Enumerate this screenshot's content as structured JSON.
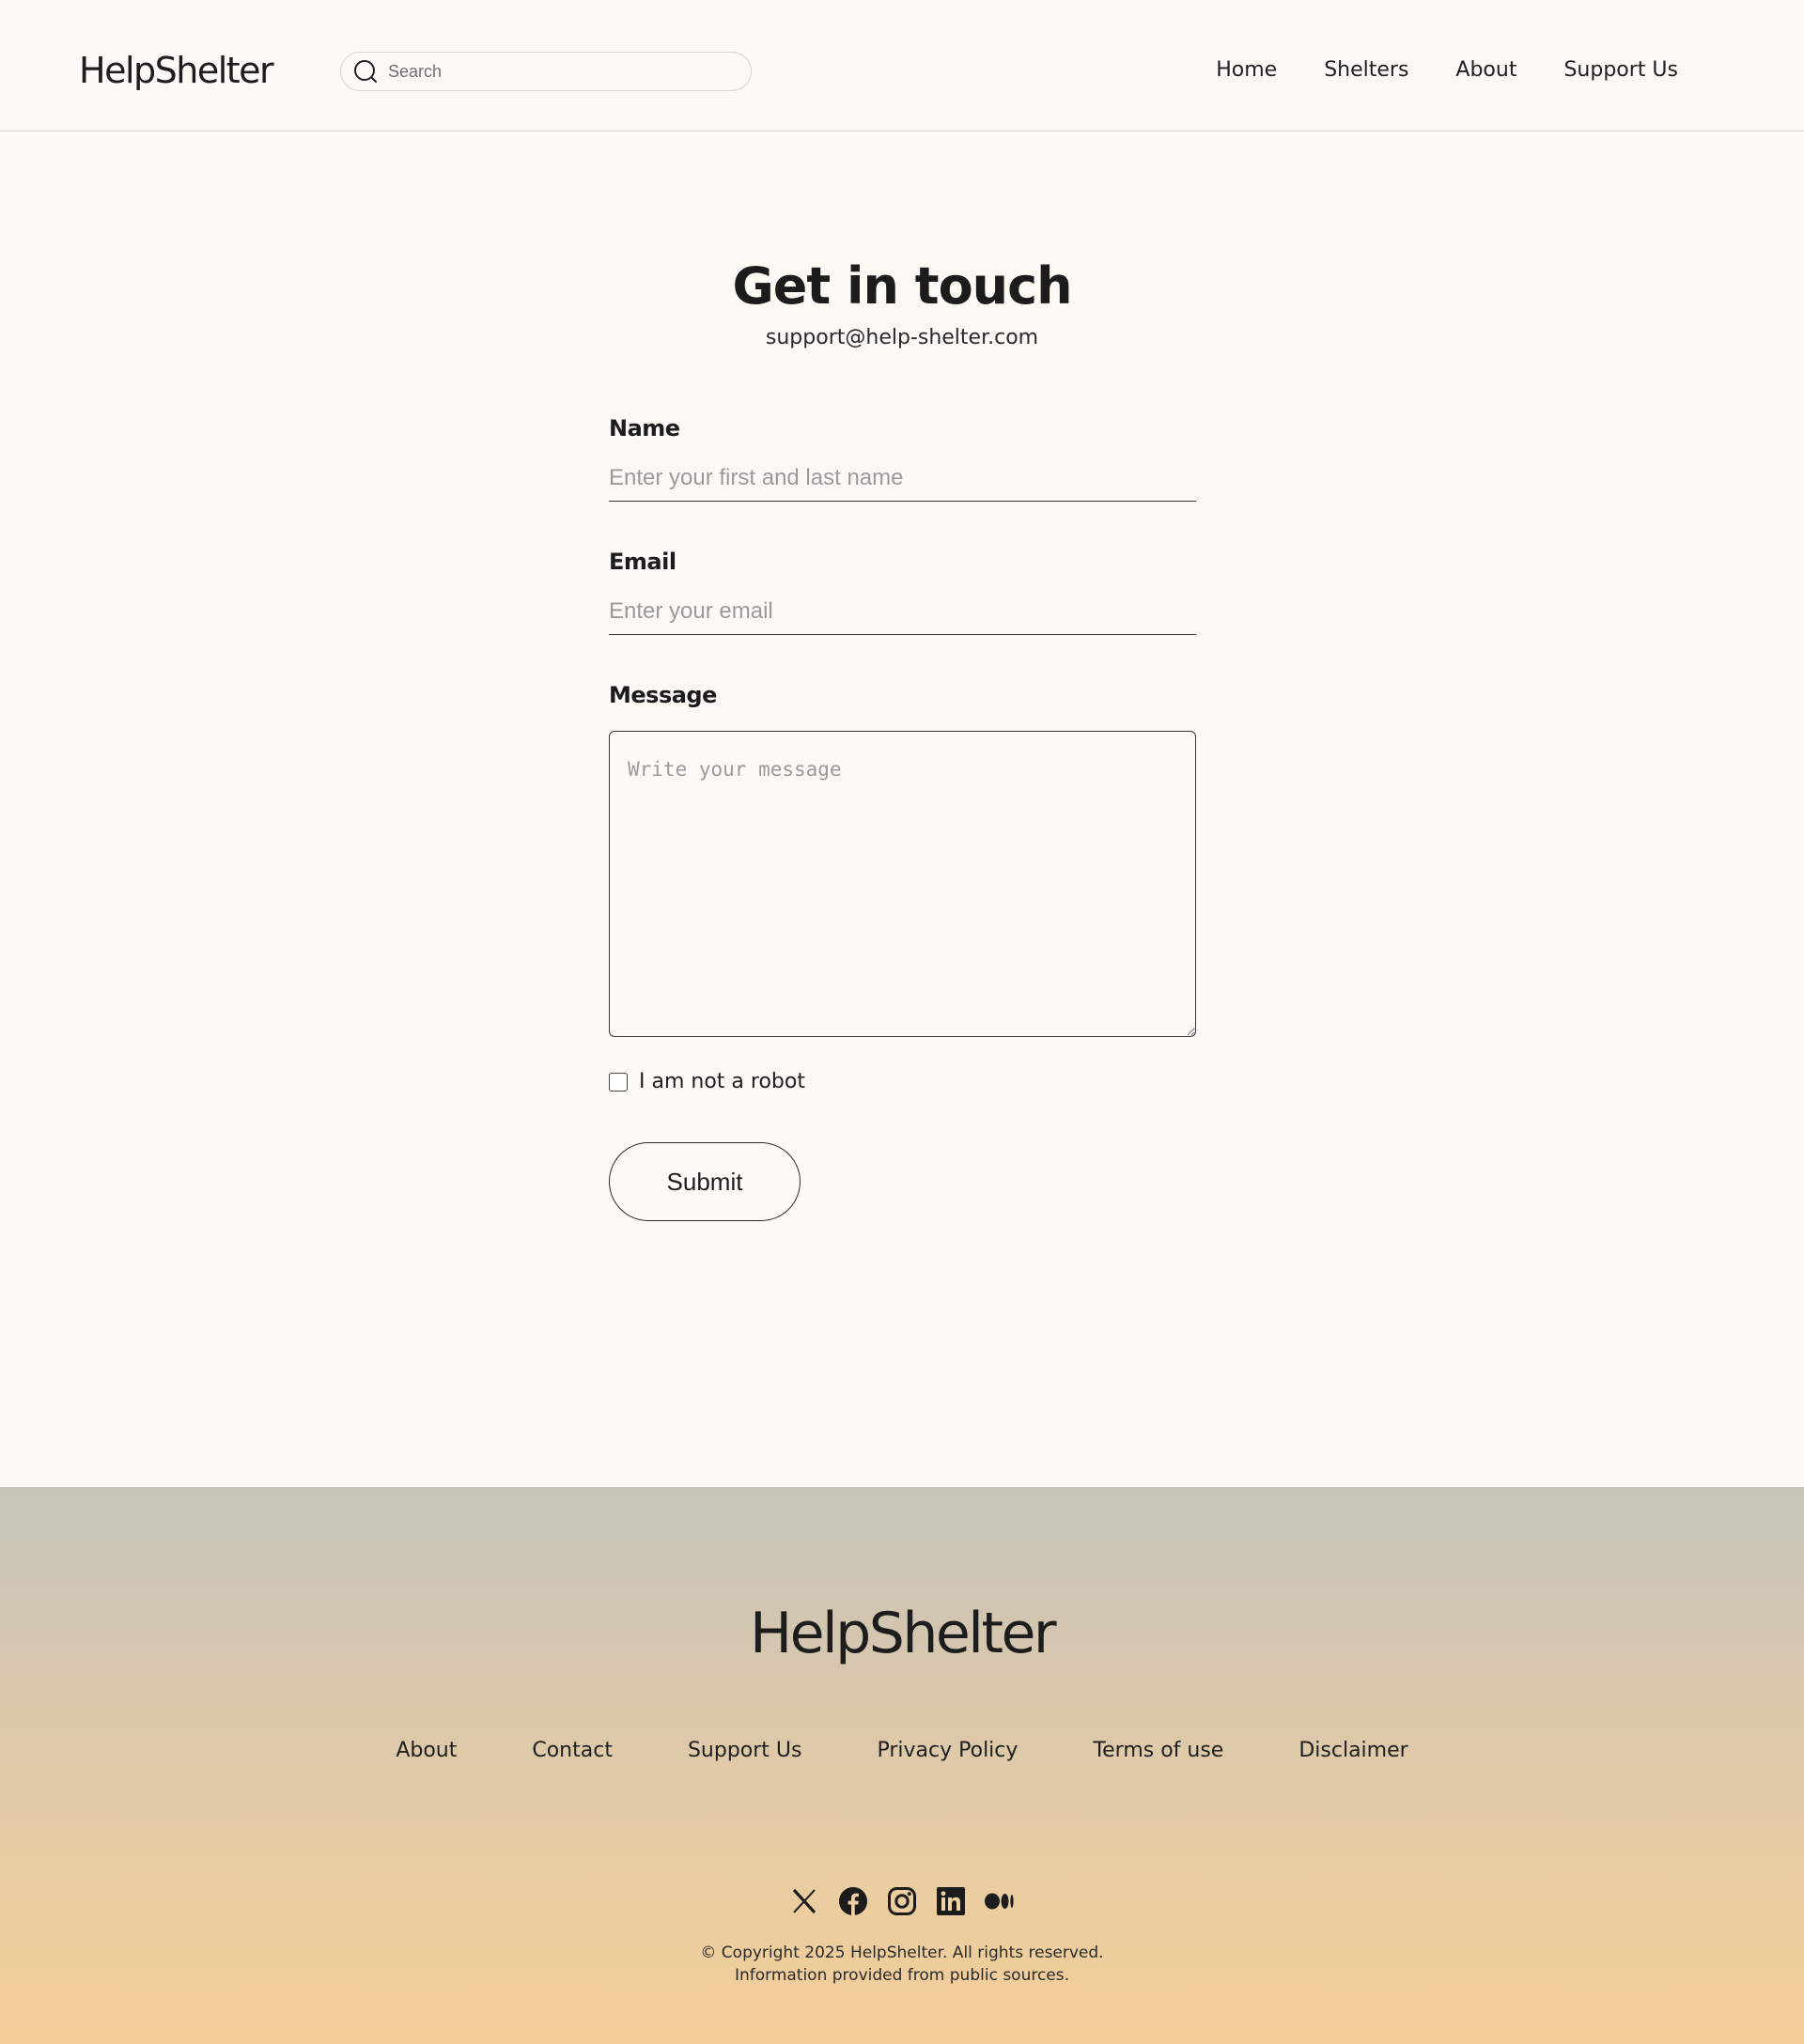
{
  "header": {
    "logo": "HelpShelter",
    "search_placeholder": "Search",
    "nav": [
      "Home",
      "Shelters",
      "About",
      "Support Us"
    ]
  },
  "main": {
    "title": "Get in touch",
    "email": "support@help-shelter.com",
    "form": {
      "name_label": "Name",
      "name_placeholder": "Enter your first and last name",
      "email_label": "Email",
      "email_placeholder": "Enter your email",
      "message_label": "Message",
      "message_placeholder": "Write your message",
      "robot_label": "I am not a robot",
      "robot_checked": false,
      "submit_label": "Submit"
    }
  },
  "footer": {
    "logo": "HelpShelter",
    "links": [
      "About",
      "Contact",
      "Support Us",
      "Privacy Policy",
      "Terms of use",
      "Disclaimer"
    ],
    "socials": [
      "x-icon",
      "facebook-icon",
      "instagram-icon",
      "linkedin-icon",
      "medium-icon"
    ],
    "copyright_line1": "© Copyright 2025 HelpShelter. All rights reserved.",
    "copyright_line2": "Information provided from public sources."
  }
}
